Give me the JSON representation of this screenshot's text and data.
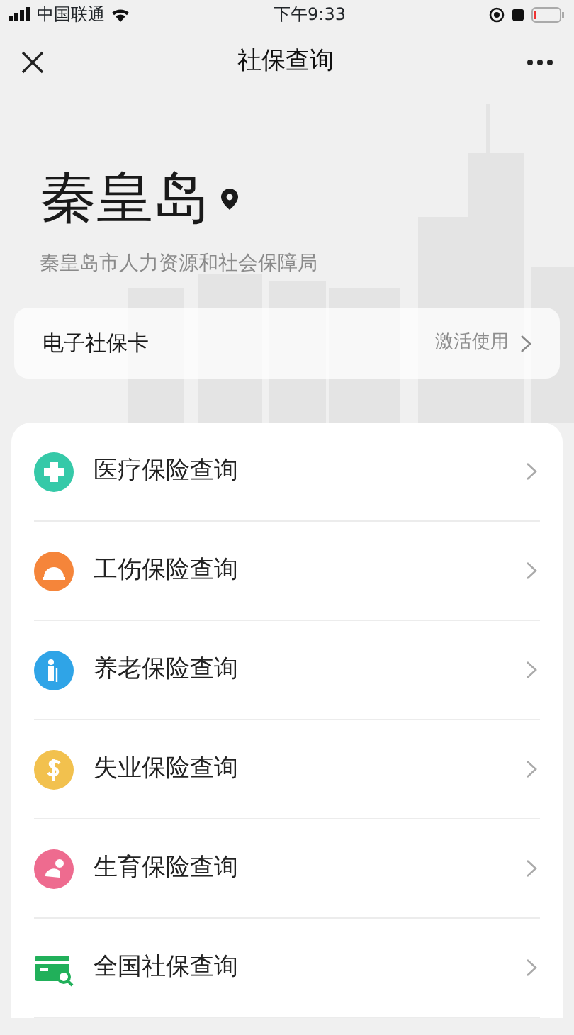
{
  "status_bar": {
    "carrier": "中国联通",
    "time": "下午9:33"
  },
  "nav": {
    "title": "社保查询"
  },
  "header": {
    "city": "秦皇岛",
    "bureau": "秦皇岛市人力资源和社会保障局"
  },
  "card": {
    "label": "电子社保卡",
    "action": "激活使用"
  },
  "items": [
    {
      "label": "医疗保险查询",
      "kind": "medical",
      "color": "#35c9a8"
    },
    {
      "label": "工伤保险查询",
      "kind": "injury",
      "color": "#f5853a"
    },
    {
      "label": "养老保险查询",
      "kind": "pension",
      "color": "#2fa4e7"
    },
    {
      "label": "失业保险查询",
      "kind": "unemployment",
      "color": "#f2c14e"
    },
    {
      "label": "生育保险查询",
      "kind": "maternity",
      "color": "#ee6b8f"
    },
    {
      "label": "全国社保查询",
      "kind": "national",
      "color": "#21b05a"
    }
  ]
}
